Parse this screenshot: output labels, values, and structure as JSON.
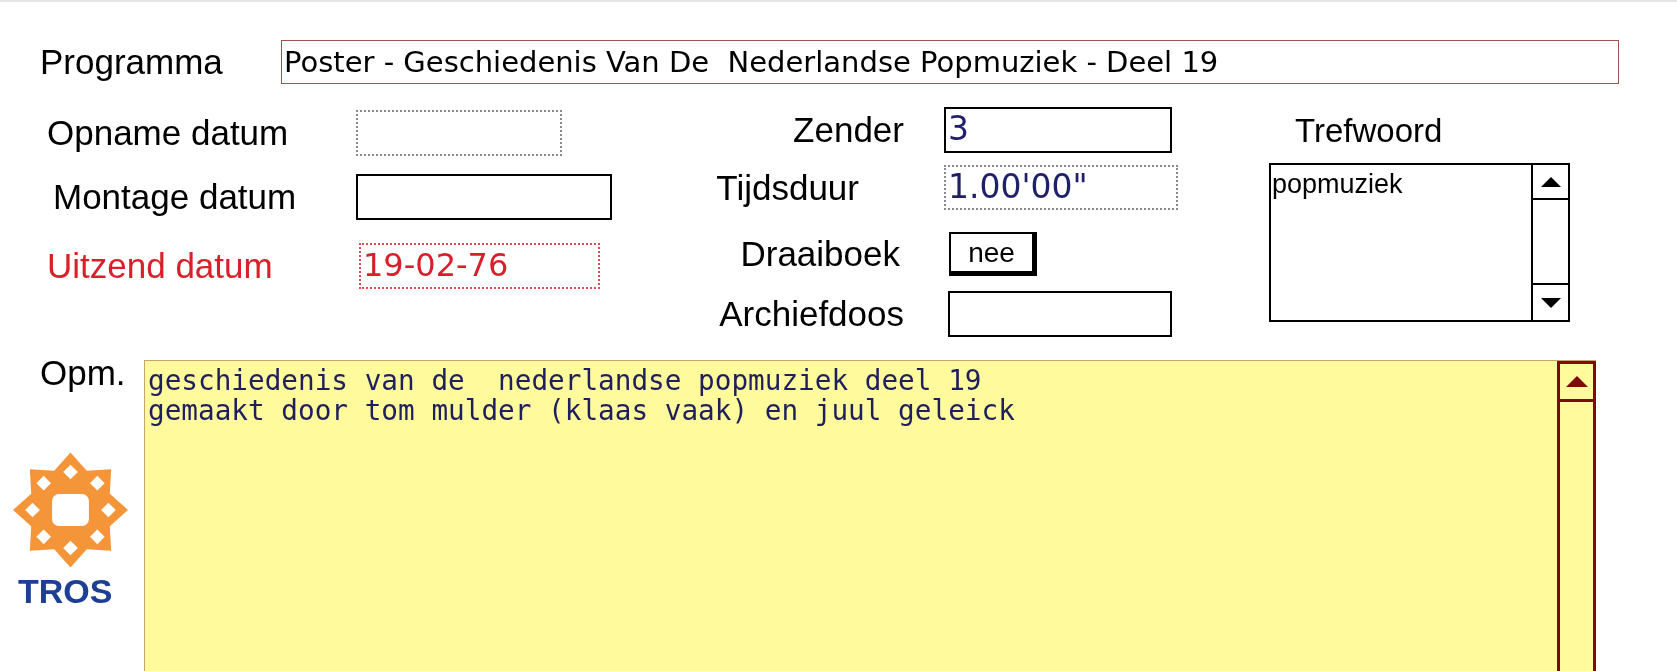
{
  "program": {
    "label": "Programma",
    "value": "Poster - Geschiedenis Van De  Nederlandse Popmuziek - Deel 19"
  },
  "date_fields": [
    {
      "label": "Opname datum",
      "dotted": true,
      "highlighted": false
    },
    {
      "label": "Montage datum",
      "dotted": false,
      "highlighted": false
    },
    {
      "label": "Uitzend datum",
      "value": "19-02-76",
      "dotted": true,
      "highlighted": true
    }
  ],
  "details": [
    {
      "kind": "field",
      "label": "Zender",
      "value": "3",
      "dotted": false
    },
    {
      "kind": "field",
      "label": "Tijdsduur",
      "value": "1.00'00\"",
      "dotted": true
    },
    {
      "kind": "button",
      "label": "Draaiboek",
      "value": "nee"
    },
    {
      "kind": "field",
      "label": "Archiefdoos",
      "dotted": false
    }
  ],
  "keywords": {
    "label": "Trefwoord",
    "items": [
      "popmuziek"
    ]
  },
  "remarks": {
    "label": "Opm.",
    "lines": [
      "geschiedenis van de  nederlandse popmuziek deel 19",
      "gemaakt door tom mulder (klaas vaak) en juul geleick"
    ]
  },
  "logo": {
    "text": "TROS"
  }
}
